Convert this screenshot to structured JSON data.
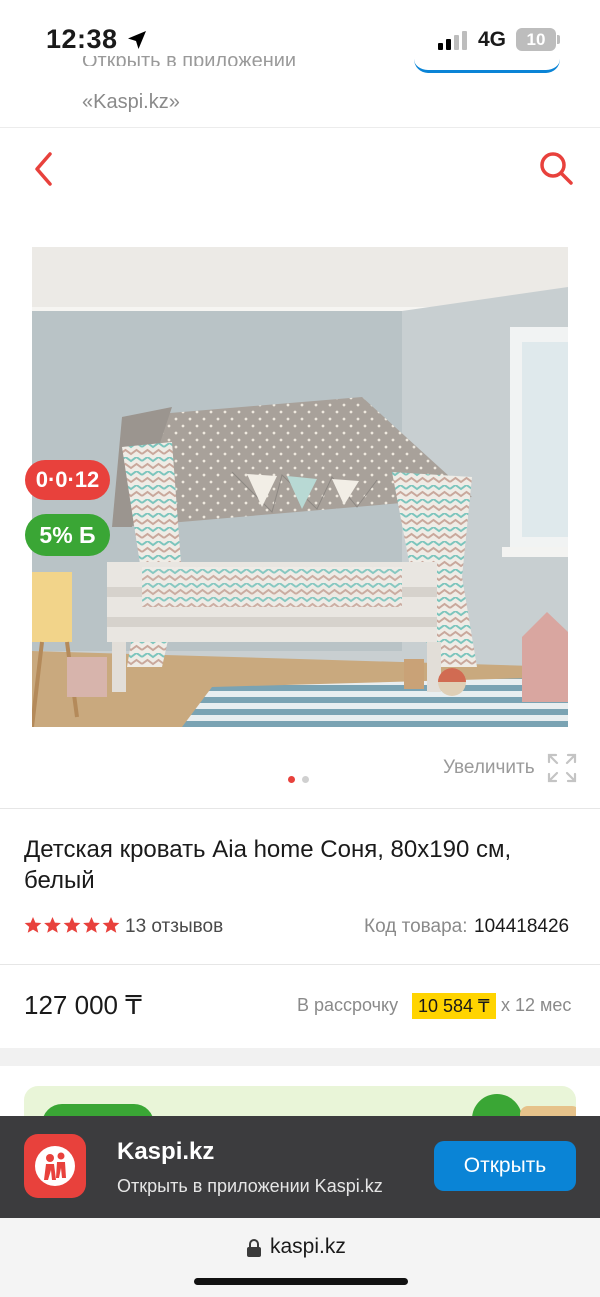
{
  "status_bar": {
    "time": "12:38",
    "network": "4G",
    "battery": "10"
  },
  "top_banner": {
    "cut_text": "Открыть в приложении",
    "text": "«Kaspi.kz»"
  },
  "nav": {
    "back_icon": "chevron-left-icon",
    "search_icon": "search-icon",
    "accent_color": "#e8413c"
  },
  "product": {
    "image_desc_icon": "product-photo",
    "badge_installment": "0·0·12",
    "badge_bonus": "5% Б",
    "zoom_label": "Увеличить",
    "title": "Детская кровать Aia home Соня, 80х190 см, белый",
    "rating": 5,
    "reviews": "13 отзывов",
    "sku_label": "Код товара:",
    "sku_value": "104418426",
    "price": "127 000 ₸",
    "installment_label": "В рассрочку",
    "installment_amount": "10 584 ₸",
    "installment_term": "х 12 мес"
  },
  "app_banner": {
    "name": "Kaspi.kz",
    "subtitle": "Открыть в приложении Kaspi.kz",
    "open_button": "Открыть"
  },
  "url_bar": {
    "url": "kaspi.kz"
  }
}
